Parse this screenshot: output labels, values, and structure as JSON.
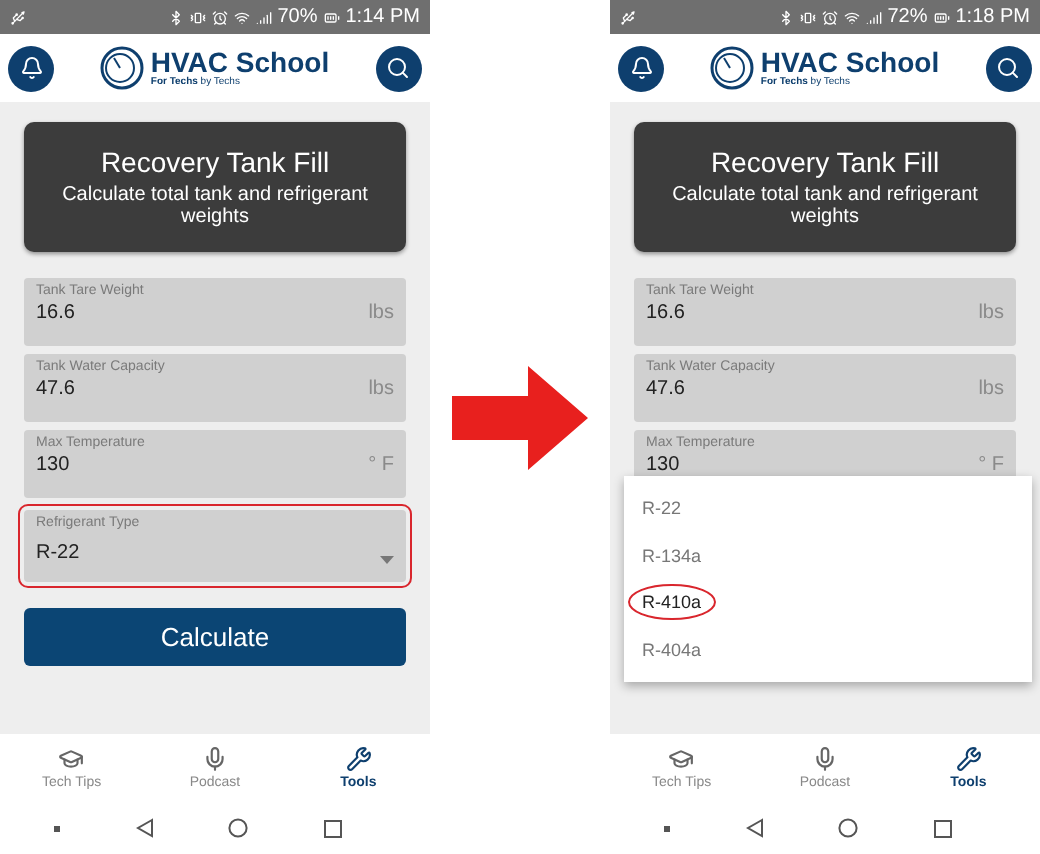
{
  "screens": [
    {
      "status_bar": {
        "battery": "70%",
        "time": "1:14 PM"
      },
      "header": {
        "title": "HVAC School",
        "tagline": "**For Techs** by Techs"
      },
      "card": {
        "title": "Recovery Tank Fill",
        "subtitle": "Calculate total tank and refrigerant weights"
      },
      "fields": [
        {
          "kind": "input",
          "label": "Tank Tare Weight",
          "value": "16.6",
          "unit": "lbs",
          "highlighted": false
        },
        {
          "kind": "input",
          "label": "Tank Water Capacity",
          "value": "47.6",
          "unit": "lbs",
          "highlighted": false
        },
        {
          "kind": "input",
          "label": "Max Temperature",
          "value": "130",
          "unit": "° F",
          "highlighted": false
        },
        {
          "kind": "select",
          "label": "Refrigerant Type",
          "value": "R-22",
          "highlighted": true
        }
      ],
      "button": "Calculate",
      "nav": [
        {
          "label": "Tech Tips",
          "selected": false
        },
        {
          "label": "Podcast",
          "selected": false
        },
        {
          "label": "Tools",
          "selected": true
        }
      ]
    },
    {
      "status_bar": {
        "battery": "72%",
        "time": "1:18 PM"
      },
      "header": {
        "title": "HVAC School",
        "tagline": "**For Techs** by Techs"
      },
      "card": {
        "title": "Recovery Tank Fill",
        "subtitle": "Calculate total tank and refrigerant weights"
      },
      "fields": [
        {
          "kind": "input",
          "label": "Tank Tare Weight",
          "value": "16.6",
          "unit": "lbs",
          "highlighted": false
        },
        {
          "kind": "input",
          "label": "Tank Water Capacity",
          "value": "47.6",
          "unit": "lbs",
          "highlighted": false
        },
        {
          "kind": "input",
          "label": "Max Temperature",
          "value": "130",
          "unit": "° F",
          "highlighted": false
        }
      ],
      "dropdown": [
        {
          "label": "R-22",
          "circled": false
        },
        {
          "label": "R-134a",
          "circled": false
        },
        {
          "label": "R-410a",
          "circled": true
        },
        {
          "label": "R-404a",
          "circled": false
        }
      ],
      "nav": [
        {
          "label": "Tech Tips",
          "selected": false
        },
        {
          "label": "Podcast",
          "selected": false
        },
        {
          "label": "Tools",
          "selected": true
        }
      ]
    }
  ]
}
